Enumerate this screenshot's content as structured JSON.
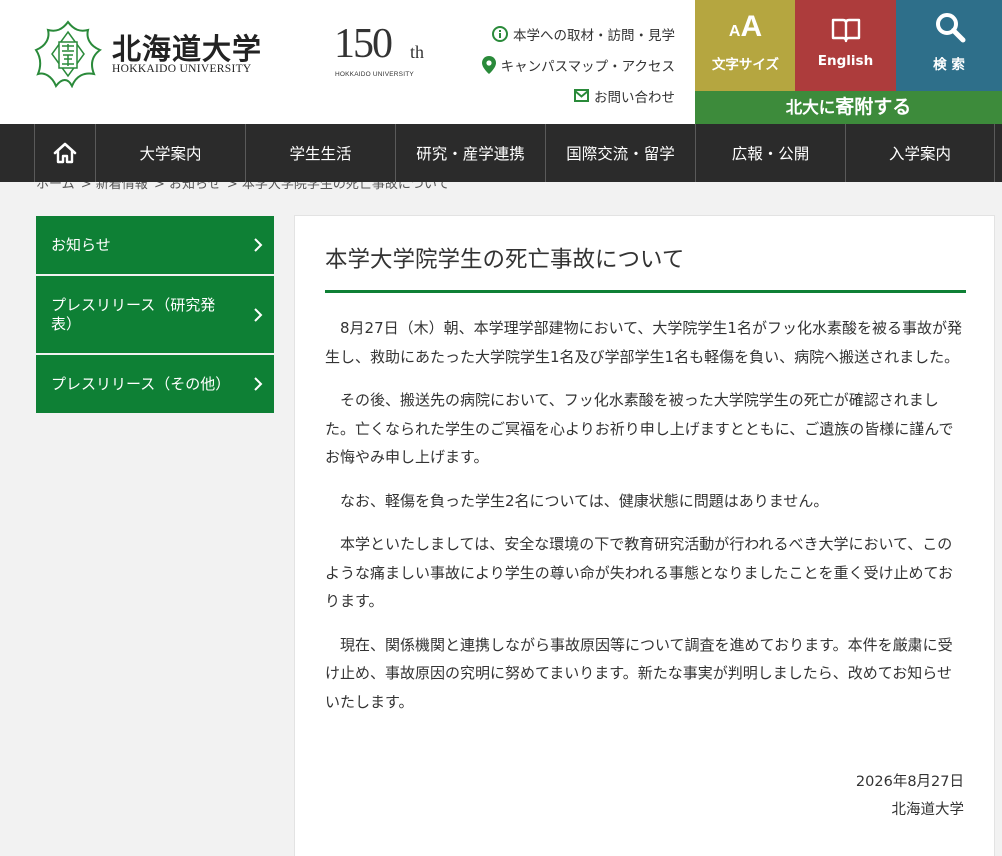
{
  "header": {
    "logo_ja": "北海道大学",
    "logo_en": "HOKKAIDO UNIVERSITY",
    "anniversary": {
      "number": "150",
      "suffix": "th",
      "sub": "HOKKAIDO UNIVERSITY"
    },
    "util_links": [
      {
        "label": "本学への取材・訪問・見学",
        "icon": "info-icon"
      },
      {
        "label": "キャンパスマップ・アクセス",
        "icon": "map-pin-icon"
      },
      {
        "label": "お問い合わせ",
        "icon": "mail-icon"
      }
    ],
    "tiles": {
      "font_size": {
        "glyph_small": "A",
        "glyph_big": "A",
        "label": "文字サイズ"
      },
      "english": {
        "label": "English"
      },
      "search": {
        "label": "検 索"
      }
    },
    "donate": {
      "prefix": "北大に",
      "emphasis": "寄附する"
    },
    "colors": {
      "font_tile": "#b5a640",
      "english_tile": "#ad3c3c",
      "search_tile": "#2e6f8a",
      "donate": "#3d8b3b",
      "brand_green": "#0e8035"
    }
  },
  "gnav": {
    "home_icon": "home-icon",
    "items": [
      "大学案内",
      "学生生活",
      "研究・産学連携",
      "国際交流・留学",
      "広報・公開",
      "入学案内"
    ]
  },
  "breadcrumb": [
    "ホーム",
    "新着情報",
    "お知らせ",
    "本学大学院学生の死亡事故について"
  ],
  "sidebar": {
    "items": [
      {
        "label": "お知らせ"
      },
      {
        "label": "プレスリリース（研究発表）"
      },
      {
        "label": "プレスリリース（その他）"
      }
    ]
  },
  "article": {
    "title": "本学大学院学生の死亡事故について",
    "paragraphs": [
      "8月27日（木）朝、本学理学部建物において、大学院学生1名がフッ化水素酸を被る事故が発生し、救助にあたった大学院学生1名及び学部学生1名も軽傷を負い、病院へ搬送されました。",
      "その後、搬送先の病院において、フッ化水素酸を被った大学院学生の死亡が確認されました。亡くなられた学生のご冥福を心よりお祈り申し上げますとともに、ご遺族の皆様に謹んでお悔やみ申し上げます。",
      "なお、軽傷を負った学生2名については、健康状態に問題はありません。",
      "本学といたしましては、安全な環境の下で教育研究活動が行われるべき大学において、このような痛ましい事故により学生の尊い命が失われる事態となりましたことを重く受け止めております。",
      "現在、関係機関と連携しながら事故原因等について調査を進めております。本件を厳粛に受け止め、事故原因の究明に努めてまいります。新たな事実が判明しましたら、改めてお知らせいたします。"
    ],
    "date": "2026年8月27日",
    "signature": "北海道大学"
  }
}
